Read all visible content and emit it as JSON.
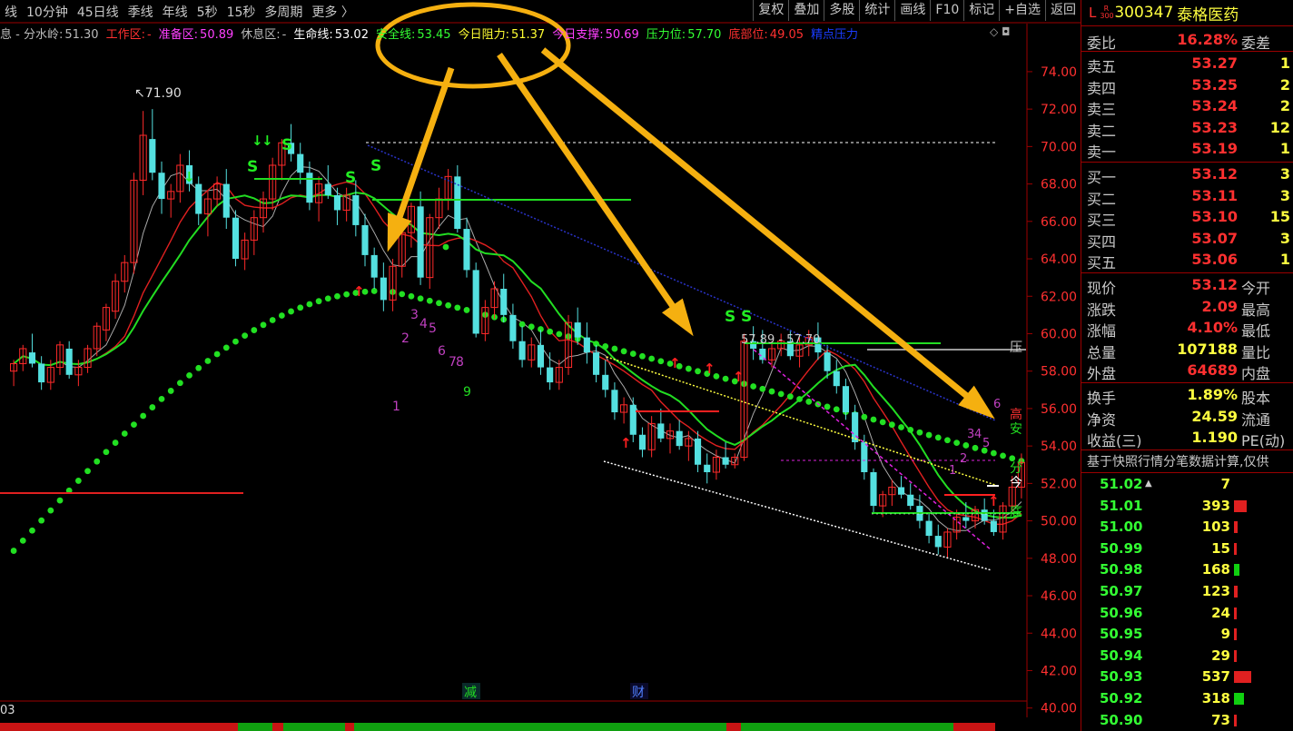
{
  "tabs": [
    "线",
    "10分钟",
    "45日线",
    "季线",
    "年线",
    "5秒",
    "15秒",
    "多周期",
    "更多 〉"
  ],
  "toolbar": [
    "复权",
    "叠加",
    "多股",
    "统计",
    "画线",
    "F10",
    "标记",
    "+自选",
    "返回"
  ],
  "indicators": [
    {
      "label": "息 - 分水岭:",
      "value": "51.30",
      "color": "#bbbbbb"
    },
    {
      "label": "工作区:",
      "value": "-",
      "color": "#ff3030"
    },
    {
      "label": "准备区:",
      "value": "50.89",
      "color": "#ff40ff"
    },
    {
      "label": "休息区:",
      "value": "-",
      "color": "#bbbbbb"
    },
    {
      "label": "生命线:",
      "value": "53.02",
      "color": "#ffffff"
    },
    {
      "label": "安全线:",
      "value": "53.45",
      "color": "#33ff33"
    },
    {
      "label": "今日阻力:",
      "value": "51.37",
      "color": "#ffff33"
    },
    {
      "label": "今日支撑:",
      "value": "50.69",
      "color": "#ff40ff"
    },
    {
      "label": "压力位:",
      "value": "57.70",
      "color": "#33ff33"
    },
    {
      "label": "底部位:",
      "value": "49.05",
      "color": "#ff3030"
    },
    {
      "label": "精点压力",
      "value": "",
      "color": "#1a3cff"
    }
  ],
  "stock": {
    "flag": "L",
    "badge_top": "R",
    "badge_bottom": "300",
    "code": "300347",
    "name": "泰格医药"
  },
  "weibi": {
    "label": "委比",
    "value": "16.28%",
    "label2": "委差"
  },
  "sell": [
    {
      "label": "卖五",
      "price": "53.27",
      "vol": "1"
    },
    {
      "label": "卖四",
      "price": "53.25",
      "vol": "2"
    },
    {
      "label": "卖三",
      "price": "53.24",
      "vol": "2"
    },
    {
      "label": "卖二",
      "price": "53.23",
      "vol": "12"
    },
    {
      "label": "卖一",
      "price": "53.19",
      "vol": "1"
    }
  ],
  "buy": [
    {
      "label": "买一",
      "price": "53.12",
      "vol": "3"
    },
    {
      "label": "买二",
      "price": "53.11",
      "vol": "3"
    },
    {
      "label": "买三",
      "price": "53.10",
      "vol": "15"
    },
    {
      "label": "买四",
      "price": "53.07",
      "vol": "3"
    },
    {
      "label": "买五",
      "price": "53.06",
      "vol": "1"
    }
  ],
  "stats": [
    {
      "label": "现价",
      "value": "53.12",
      "label2": "今开"
    },
    {
      "label": "涨跌",
      "value": "2.09",
      "label2": "最高"
    },
    {
      "label": "涨幅",
      "value": "4.10%",
      "label2": "最低"
    },
    {
      "label": "总量",
      "value": "107188",
      "label2": "量比"
    },
    {
      "label": "外盘",
      "value": "64689",
      "label2": "内盘"
    }
  ],
  "stats2": [
    {
      "label": "换手",
      "value": "1.89%",
      "label2": "股本"
    },
    {
      "label": "净资",
      "value": "24.59",
      "label2": "流通"
    },
    {
      "label": "收益(三)",
      "value": "1.190",
      "label2": "PE(动)"
    }
  ],
  "note": "基于快照行情分笔数据计算,仅供",
  "ticks": [
    {
      "price": "51.02",
      "vol": "7",
      "bar": 0,
      "mark": "▲"
    },
    {
      "price": "51.01",
      "vol": "393",
      "bar": 0.45,
      "color": "#e02020"
    },
    {
      "price": "51.00",
      "vol": "103",
      "bar": 0.12,
      "color": "#e02020"
    },
    {
      "price": "50.99",
      "vol": "15",
      "bar": 0.02,
      "color": "#e02020"
    },
    {
      "price": "50.98",
      "vol": "168",
      "bar": 0.19,
      "color": "#10d010"
    },
    {
      "price": "50.97",
      "vol": "123",
      "bar": 0.14,
      "color": "#e02020"
    },
    {
      "price": "50.96",
      "vol": "24",
      "bar": 0.03,
      "color": "#e02020"
    },
    {
      "price": "50.95",
      "vol": "9",
      "bar": 0.01,
      "color": "#e02020"
    },
    {
      "price": "50.94",
      "vol": "29",
      "bar": 0.03,
      "color": "#e02020"
    },
    {
      "price": "50.93",
      "vol": "537",
      "bar": 0.62,
      "color": "#e02020"
    },
    {
      "price": "50.92",
      "vol": "318",
      "bar": 0.37,
      "color": "#10d010"
    },
    {
      "price": "50.90",
      "vol": "73",
      "bar": 0.08,
      "color": "#e02020"
    }
  ],
  "chart_data": {
    "type": "candlestick",
    "y_ticks": [
      "74.00",
      "72.00",
      "70.00",
      "68.00",
      "66.00",
      "64.00",
      "62.00",
      "60.00",
      "58.00",
      "56.00",
      "54.00",
      "52.00",
      "50.00",
      "48.00",
      "46.00",
      "44.00",
      "42.00",
      "40.00"
    ],
    "ylim": [
      39.5,
      75.5
    ],
    "x_count": 110,
    "high_label": "71.90",
    "range_label": "57.89 - 57.70",
    "right_labels": [
      "压",
      "高",
      "安",
      "分",
      "今",
      "底"
    ],
    "bottom_labels": [
      "减",
      "财"
    ],
    "left_bottom_label": "03",
    "wave_labels_magenta": [
      "1",
      "2",
      "3",
      "4",
      "5",
      "6",
      "7",
      "8"
    ],
    "wave_label_green": "9",
    "wave_labels_right": [
      "1",
      "2",
      "3",
      "4",
      "5",
      "6"
    ],
    "signal_s": "S",
    "candles": [
      [
        58.0,
        58.6,
        57.2,
        58.4
      ],
      [
        58.4,
        59.4,
        58.0,
        59.2
      ],
      [
        59.0,
        60.0,
        58.2,
        58.4
      ],
      [
        58.4,
        58.8,
        57.0,
        57.4
      ],
      [
        57.4,
        58.6,
        57.0,
        58.2
      ],
      [
        58.2,
        59.6,
        57.8,
        59.4
      ],
      [
        59.2,
        59.6,
        57.6,
        57.8
      ],
      [
        57.8,
        58.6,
        57.2,
        58.2
      ],
      [
        58.2,
        59.4,
        57.9,
        59.2
      ],
      [
        59.2,
        60.6,
        58.8,
        60.4
      ],
      [
        60.2,
        61.6,
        59.6,
        61.4
      ],
      [
        61.2,
        63.2,
        60.8,
        62.8
      ],
      [
        62.8,
        64.2,
        62.2,
        63.8
      ],
      [
        63.8,
        68.6,
        63.2,
        68.2
      ],
      [
        68.2,
        71.9,
        67.4,
        70.6
      ],
      [
        70.4,
        72.0,
        68.2,
        68.6
      ],
      [
        68.6,
        69.2,
        66.4,
        67.2
      ],
      [
        67.2,
        68.0,
        66.2,
        67.6
      ],
      [
        67.6,
        69.6,
        67.0,
        69.0
      ],
      [
        69.0,
        69.8,
        67.6,
        68.0
      ],
      [
        68.0,
        68.4,
        65.8,
        66.4
      ],
      [
        66.4,
        67.6,
        65.2,
        67.2
      ],
      [
        67.2,
        68.4,
        66.8,
        68.0
      ],
      [
        68.0,
        68.8,
        65.6,
        66.2
      ],
      [
        66.2,
        66.6,
        63.6,
        64.0
      ],
      [
        64.0,
        65.4,
        63.4,
        65.0
      ],
      [
        65.0,
        66.6,
        64.2,
        66.2
      ],
      [
        66.2,
        67.6,
        65.4,
        67.2
      ],
      [
        67.2,
        69.4,
        66.6,
        69.0
      ],
      [
        69.0,
        70.4,
        68.2,
        70.2
      ],
      [
        70.2,
        71.2,
        69.2,
        69.6
      ],
      [
        69.6,
        70.2,
        68.0,
        68.6
      ],
      [
        68.6,
        69.2,
        66.6,
        67.0
      ],
      [
        67.0,
        68.4,
        66.0,
        68.0
      ],
      [
        68.0,
        69.0,
        67.2,
        67.4
      ],
      [
        67.4,
        67.8,
        65.8,
        66.6
      ],
      [
        66.6,
        67.8,
        66.0,
        67.4
      ],
      [
        67.4,
        68.2,
        65.2,
        65.8
      ],
      [
        65.8,
        66.4,
        63.6,
        64.2
      ],
      [
        64.2,
        64.6,
        62.4,
        63.0
      ],
      [
        63.0,
        63.8,
        61.2,
        61.8
      ],
      [
        61.8,
        64.0,
        61.2,
        63.6
      ],
      [
        63.6,
        65.6,
        63.0,
        65.4
      ],
      [
        65.4,
        67.0,
        64.6,
        66.8
      ],
      [
        66.8,
        67.6,
        62.6,
        63.0
      ],
      [
        63.0,
        66.4,
        62.4,
        66.2
      ],
      [
        66.2,
        67.8,
        65.6,
        67.2
      ],
      [
        67.2,
        68.8,
        66.6,
        68.4
      ],
      [
        68.4,
        69.0,
        65.4,
        65.6
      ],
      [
        65.6,
        66.2,
        63.0,
        63.4
      ],
      [
        63.4,
        63.8,
        59.8,
        60.0
      ],
      [
        60.0,
        61.8,
        59.6,
        61.4
      ],
      [
        61.4,
        62.8,
        60.8,
        62.4
      ],
      [
        62.4,
        63.2,
        60.6,
        61.0
      ],
      [
        61.0,
        61.6,
        59.2,
        59.6
      ],
      [
        59.6,
        60.4,
        58.2,
        58.6
      ],
      [
        58.6,
        59.8,
        58.2,
        59.4
      ],
      [
        59.4,
        60.2,
        57.8,
        58.2
      ],
      [
        58.2,
        59.0,
        57.0,
        57.4
      ],
      [
        57.4,
        58.6,
        57.0,
        58.2
      ],
      [
        58.2,
        61.0,
        57.8,
        60.6
      ],
      [
        60.6,
        61.4,
        59.4,
        59.8
      ],
      [
        59.8,
        60.6,
        58.4,
        59.0
      ],
      [
        59.0,
        59.4,
        57.4,
        57.8
      ],
      [
        57.8,
        58.6,
        56.6,
        57.0
      ],
      [
        57.0,
        57.4,
        55.4,
        55.8
      ],
      [
        55.8,
        56.6,
        55.2,
        56.2
      ],
      [
        56.2,
        56.6,
        54.2,
        54.6
      ],
      [
        54.6,
        55.0,
        53.4,
        53.8
      ],
      [
        53.8,
        55.6,
        53.4,
        55.2
      ],
      [
        55.2,
        56.0,
        54.2,
        54.4
      ],
      [
        54.4,
        55.2,
        53.6,
        54.8
      ],
      [
        54.8,
        55.4,
        53.8,
        54.0
      ],
      [
        54.0,
        54.8,
        53.2,
        54.4
      ],
      [
        54.4,
        54.8,
        52.6,
        53.0
      ],
      [
        53.0,
        53.6,
        52.0,
        52.6
      ],
      [
        52.6,
        53.8,
        52.2,
        53.4
      ],
      [
        53.4,
        54.2,
        52.8,
        53.0
      ],
      [
        53.0,
        53.6,
        52.8,
        53.4
      ],
      [
        53.4,
        60.0,
        53.2,
        59.6
      ],
      [
        59.6,
        60.4,
        58.6,
        59.2
      ],
      [
        59.2,
        60.2,
        58.4,
        58.6
      ],
      [
        58.6,
        59.6,
        58.2,
        59.2
      ],
      [
        59.2,
        60.0,
        58.8,
        59.6
      ],
      [
        59.6,
        60.2,
        58.6,
        58.8
      ],
      [
        58.8,
        59.8,
        58.2,
        59.4
      ],
      [
        59.4,
        60.2,
        58.8,
        59.8
      ],
      [
        59.8,
        60.6,
        58.6,
        59.0
      ],
      [
        59.0,
        59.4,
        57.6,
        58.0
      ],
      [
        58.0,
        58.6,
        56.8,
        57.2
      ],
      [
        57.2,
        57.6,
        55.4,
        55.8
      ],
      [
        55.8,
        56.2,
        53.8,
        54.2
      ],
      [
        54.2,
        54.6,
        52.2,
        52.6
      ],
      [
        52.6,
        52.8,
        50.4,
        50.8
      ],
      [
        50.8,
        51.6,
        50.2,
        51.4
      ],
      [
        51.4,
        52.2,
        50.8,
        51.8
      ],
      [
        51.8,
        52.4,
        51.2,
        51.4
      ],
      [
        51.4,
        52.0,
        50.6,
        50.8
      ],
      [
        50.8,
        51.4,
        49.6,
        50.0
      ],
      [
        50.0,
        50.4,
        48.8,
        49.2
      ],
      [
        49.2,
        49.8,
        48.2,
        48.6
      ],
      [
        48.6,
        49.6,
        48.0,
        49.4
      ],
      [
        49.4,
        50.6,
        49.0,
        50.2
      ],
      [
        50.2,
        51.0,
        49.6,
        50.0
      ],
      [
        50.0,
        50.8,
        49.6,
        50.6
      ],
      [
        50.6,
        51.2,
        49.8,
        50.0
      ],
      [
        50.0,
        50.6,
        49.2,
        49.4
      ],
      [
        49.4,
        51.0,
        49.0,
        50.8
      ],
      [
        50.8,
        52.4,
        50.4,
        51.8
      ],
      [
        51.8,
        53.6,
        51.2,
        53.12
      ]
    ]
  }
}
